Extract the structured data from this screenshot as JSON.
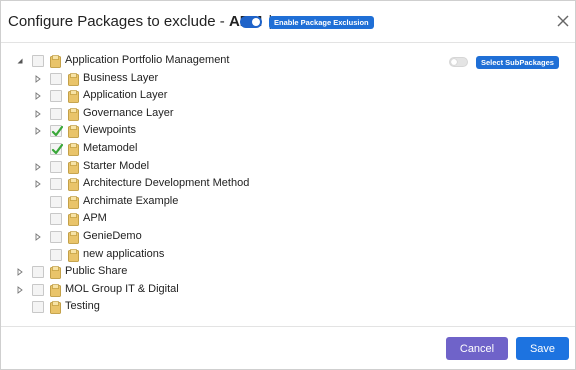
{
  "header": {
    "title_prefix": "Configure Packages to exclude - ",
    "package_name": "APM",
    "separator": "|",
    "enable_exclusion_label": "Enable Package Exclusion",
    "enable_exclusion_on": true
  },
  "select_subpackages": {
    "label": "Select SubPackages",
    "toggle_on": false
  },
  "tree": [
    {
      "label": "Application Portfolio Management",
      "level": 0,
      "arrow": "expanded",
      "checked": false
    },
    {
      "label": "Business Layer",
      "level": 1,
      "arrow": "collapsed",
      "checked": false
    },
    {
      "label": "Application Layer",
      "level": 1,
      "arrow": "collapsed",
      "checked": false
    },
    {
      "label": "Governance Layer",
      "level": 1,
      "arrow": "collapsed",
      "checked": false
    },
    {
      "label": "Viewpoints",
      "level": 1,
      "arrow": "collapsed",
      "checked": true
    },
    {
      "label": "Metamodel",
      "level": 1,
      "arrow": "none",
      "checked": true
    },
    {
      "label": "Starter Model",
      "level": 1,
      "arrow": "collapsed",
      "checked": false
    },
    {
      "label": "Architecture Development Method",
      "level": 1,
      "arrow": "collapsed",
      "checked": false
    },
    {
      "label": "Archimate Example",
      "level": 1,
      "arrow": "none",
      "checked": false
    },
    {
      "label": "APM",
      "level": 1,
      "arrow": "none",
      "checked": false
    },
    {
      "label": "GenieDemo",
      "level": 1,
      "arrow": "collapsed",
      "checked": false
    },
    {
      "label": "new applications",
      "level": 1,
      "arrow": "none",
      "checked": false
    },
    {
      "label": "Public Share",
      "level": 0,
      "arrow": "collapsed",
      "checked": false
    },
    {
      "label": "MOL Group IT & Digital",
      "level": 0,
      "arrow": "collapsed",
      "checked": false
    },
    {
      "label": "Testing",
      "level": 0,
      "arrow": "none",
      "checked": false
    }
  ],
  "footer": {
    "cancel_label": "Cancel",
    "save_label": "Save"
  },
  "colors": {
    "primary": "#1d73e0",
    "cancel": "#6f63c9",
    "check": "#3aa83a",
    "folder": "#e9c46a"
  }
}
